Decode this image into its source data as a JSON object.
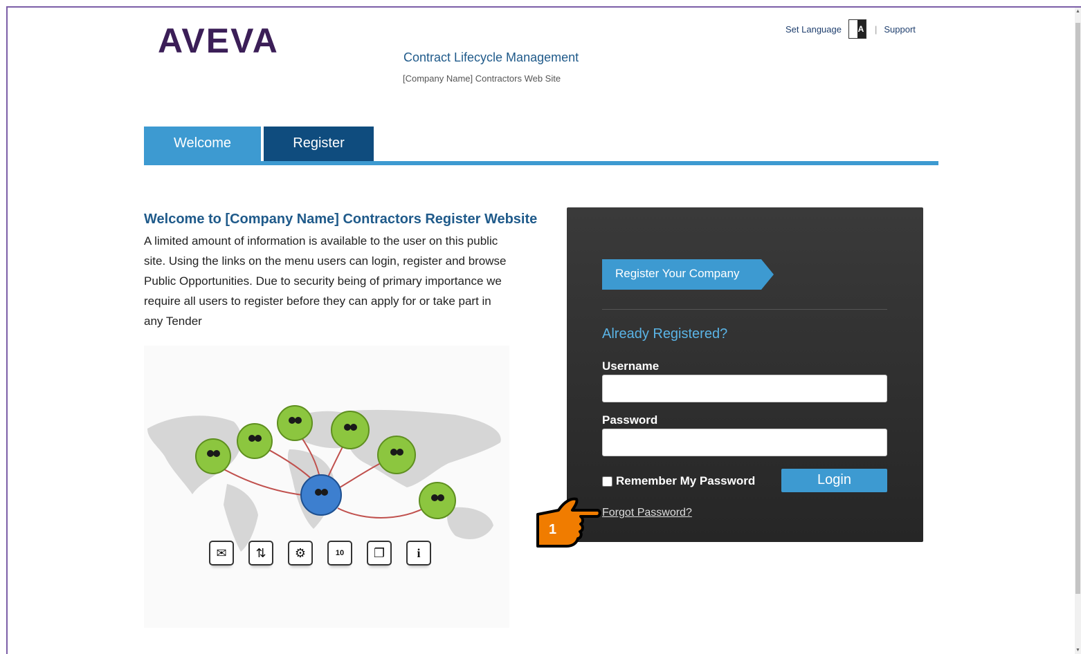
{
  "header": {
    "logo_text": "AVEVA",
    "title": "Contract Lifecycle Management",
    "subtitle": "[Company Name] Contractors Web Site",
    "set_language": "Set Language",
    "separator": "|",
    "support": "Support"
  },
  "tabs": [
    {
      "label": "Welcome",
      "active": true
    },
    {
      "label": "Register",
      "active": false
    }
  ],
  "welcome": {
    "heading": "Welcome to [Company Name] Contractors Register Website",
    "text": "A limited amount of information is available to the user on this public site. Using the links on the menu users can login, register and browse Public Opportunities. Due to security being of primary importance we require all users to register before they can apply for or take part in any Tender"
  },
  "illustration": {
    "icons": [
      "mail-icon",
      "exchange-icon",
      "settings-icon",
      "calendar-icon",
      "documents-icon",
      "info-icon"
    ],
    "calendar_number": "10"
  },
  "login_panel": {
    "register_button": "Register Your Company",
    "already_registered": "Already Registered?",
    "username_label": "Username",
    "username_value": "",
    "password_label": "Password",
    "password_value": "",
    "remember_label": "Remember My Password",
    "remember_checked": false,
    "login_button": "Login",
    "forgot_link": "Forgot Password?"
  },
  "annotation": {
    "step_number": "1"
  },
  "colors": {
    "brand": "#3b1e57",
    "accent": "#3d9ad1",
    "dark_tab": "#0f4c7e",
    "panel": "#2e2e2e",
    "pointer": "#f07c00"
  }
}
